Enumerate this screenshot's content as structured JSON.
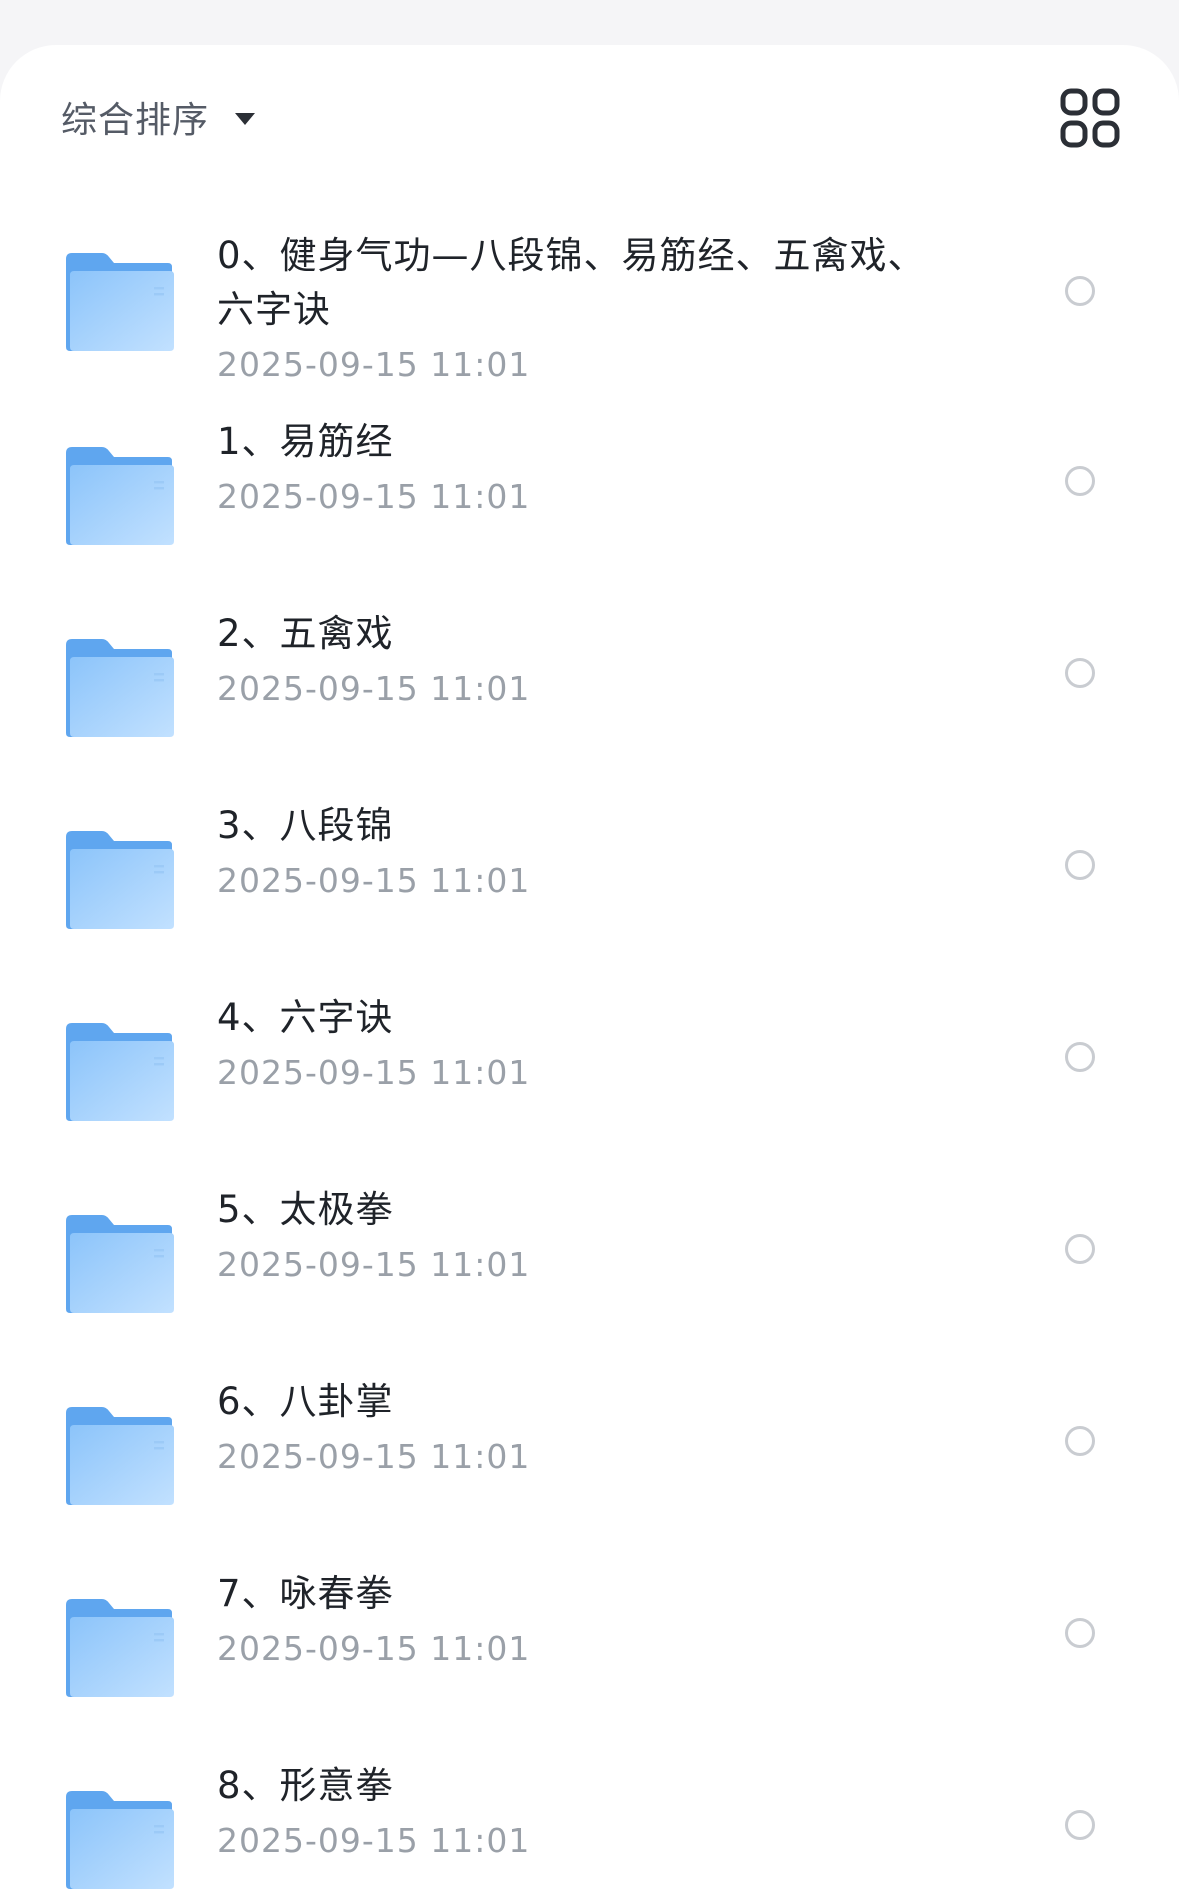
{
  "toolbar": {
    "sort_label": "综合排序",
    "sort_icon": "caret-down-icon",
    "view_toggle_icon": "grid-view-icon"
  },
  "colors": {
    "folder_light": "#b9dcff",
    "folder_dark": "#6fb0f2",
    "radio_border": "#c9ccd1",
    "name_text": "#1f2329",
    "date_text": "#9aa0a8"
  },
  "items": [
    {
      "name": "0、健身气功—八段锦、易筋经、五禽戏、六字诀",
      "date": "2025-09-15 11:01"
    },
    {
      "name": "1、易筋经",
      "date": "2025-09-15 11:01"
    },
    {
      "name": "2、五禽戏",
      "date": "2025-09-15 11:01"
    },
    {
      "name": "3、八段锦",
      "date": "2025-09-15 11:01"
    },
    {
      "name": "4、六字诀",
      "date": "2025-09-15 11:01"
    },
    {
      "name": "5、太极拳",
      "date": "2025-09-15 11:01"
    },
    {
      "name": "6、八卦掌",
      "date": "2025-09-15 11:01"
    },
    {
      "name": "7、咏春拳",
      "date": "2025-09-15 11:01"
    },
    {
      "name": "8、形意拳",
      "date": "2025-09-15 11:01"
    }
  ]
}
